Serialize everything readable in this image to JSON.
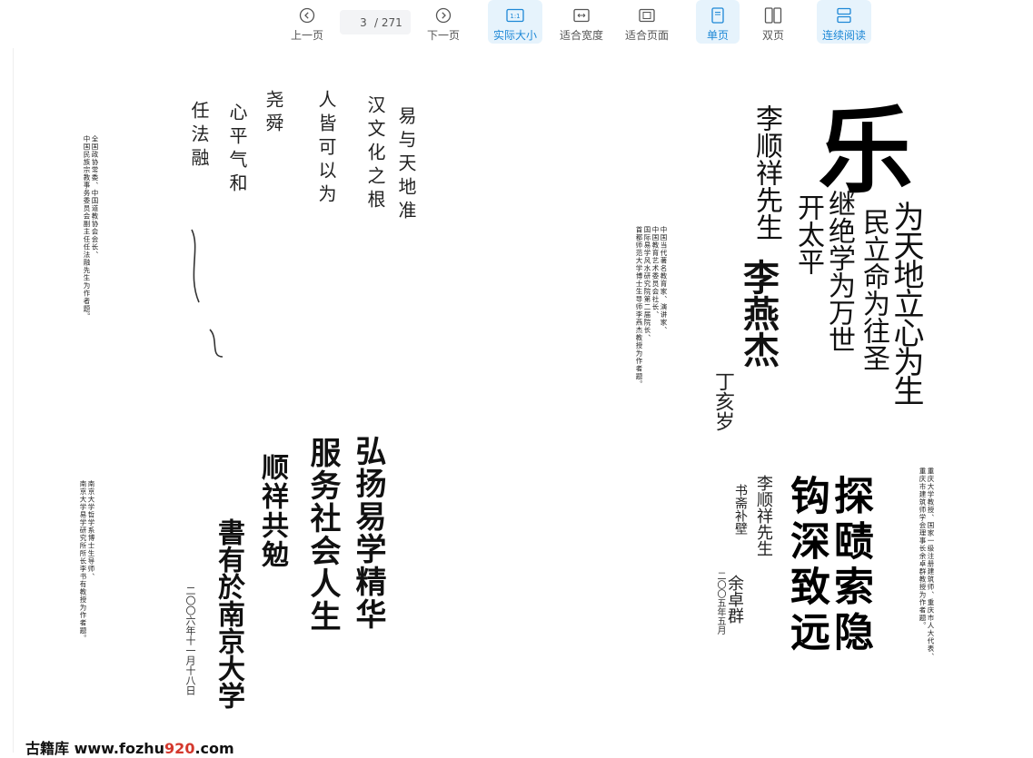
{
  "toolbar": {
    "prev_label": "上一页",
    "current_page": "3",
    "total_pages": "/ 271",
    "next_label": "下一页",
    "actual_size_label": "实际大小",
    "actual_size_icon_text": "1:1",
    "fit_width_label": "适合宽度",
    "fit_page_label": "适合页面",
    "single_page_label": "单页",
    "double_page_label": "双页",
    "continuous_label": "连续阅读",
    "accent_color": "#1e88d6",
    "active_bg": "#e6f3fc"
  },
  "page": {
    "caption_1_line1": "全国政协常委、中国道教协会会长、",
    "caption_1_line2": "中国民族宗教事务委员会副主任任法融先生为作者题。",
    "cal_1_lines": [
      "易与天地准",
      "汉文化之根",
      "人皆可以为",
      "尧舜",
      "心平气和",
      "任法融"
    ],
    "caption_2_line1": "南京大学哲学系博士生导师、",
    "caption_2_line2": "南京大学易学研究所所长李书有教授为作者题。",
    "cal_2_col1": "弘扬易学精华",
    "cal_2_col2": "服务社会人生",
    "cal_2_col3": "顺祥共勉",
    "cal_2_col4": "書有於南京大学",
    "cal_2_date": "二〇〇六年十一月十八日",
    "caption_3_line1": "中国当代著名教育家、演讲家、",
    "caption_3_line2": "中国教育艺术委员会社长、",
    "caption_3_line3": "国际易学风水研究院第二届院长、",
    "caption_3_line4": "首都师范大学博士生导师李燕杰教授为作者题。",
    "cal_3_big": "乐",
    "cal_3_col1": "为天地立心为生",
    "cal_3_col2": "民立命为往圣",
    "cal_3_col3": "继绝学为万世",
    "cal_3_col4": "开太平",
    "cal_3_dedic": "李顺祥先生",
    "cal_3_sign": "李燕杰",
    "cal_3_date": "丁亥岁",
    "caption_4_line1": "重庆大学教授、国家一级注册建筑师、重庆市人大代表、",
    "caption_4_line2": "重庆市建筑师学会理事长余卓群教授为作者题。",
    "cal_4_col1": "探赜索隐",
    "cal_4_col2": "钩深致远",
    "cal_4_dedic": "李顺祥先生",
    "cal_4_dedic2": "书斋补壁",
    "cal_4_sign": "余卓群",
    "cal_4_date": "二〇〇五年五月"
  },
  "footer": {
    "site_name": "古籍库",
    "url_prefix": "www.fozhu",
    "url_red": "920",
    "url_suffix": ".com"
  }
}
